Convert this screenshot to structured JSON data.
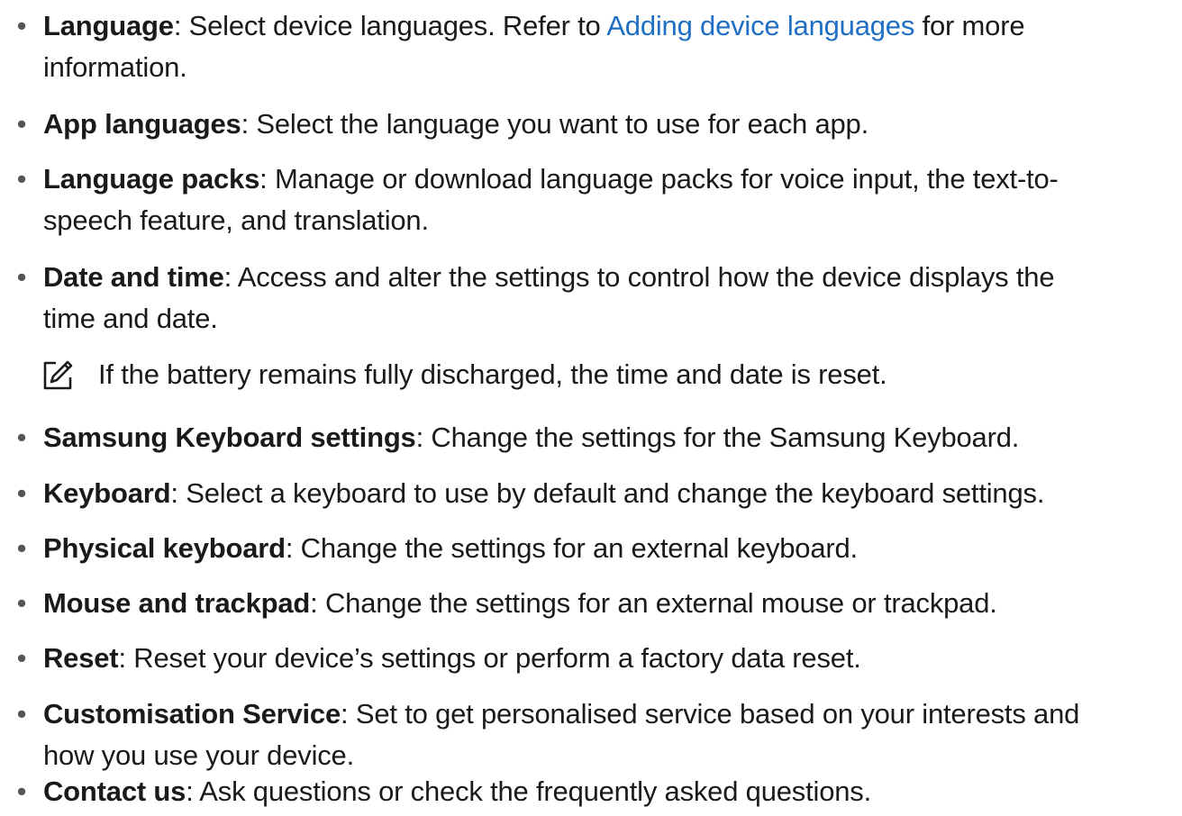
{
  "items": [
    {
      "term": "Language",
      "text_before_link": ": Select device languages. Refer to ",
      "link": "Adding device languages",
      "text_after_link": " for more",
      "line2": "information."
    },
    {
      "term": "App languages",
      "text": ": Select the language you want to use for each app."
    },
    {
      "term": "Language packs",
      "text": ": Manage or download language packs for voice input, the text-to-",
      "line2": "speech feature, and translation."
    },
    {
      "term": "Date and time",
      "text": ": Access and alter the settings to control how the device displays the",
      "line2": "time and date."
    },
    {
      "term": "Samsung Keyboard settings",
      "text": ": Change the settings for the Samsung Keyboard."
    },
    {
      "term": "Keyboard",
      "text": ": Select a keyboard to use by default and change the keyboard settings."
    },
    {
      "term": "Physical keyboard",
      "text": ": Change the settings for an external keyboard."
    },
    {
      "term": "Mouse and trackpad",
      "text": ": Change the settings for an external mouse or trackpad."
    },
    {
      "term": "Reset",
      "text": ": Reset your device’s settings or perform a factory data reset."
    },
    {
      "term": "Customisation Service",
      "text": ": Set to get personalised service based on your interests and",
      "line2": "how you use your device."
    },
    {
      "term": "Contact us",
      "text": ": Ask questions or check the frequently asked questions."
    }
  ],
  "note": {
    "icon": "note-pencil-icon",
    "text": "If the battery remains fully discharged, the time and date is reset."
  },
  "bullet_char": "•",
  "colors": {
    "text": "#1a1a1a",
    "link": "#1f6fc5",
    "icon": "#1a1a1a"
  }
}
